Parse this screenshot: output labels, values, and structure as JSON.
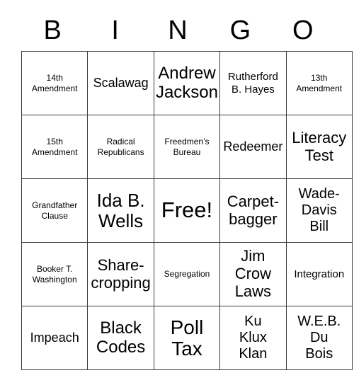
{
  "card": {
    "title": "BINGO",
    "headers": [
      "B",
      "I",
      "N",
      "G",
      "O"
    ],
    "free_space_label": "Free!",
    "rows": [
      [
        {
          "label": "14th\nAmendment",
          "size": "t-xs"
        },
        {
          "label": "Scalawag",
          "size": "t-md"
        },
        {
          "label": "Andrew\nJackson",
          "size": "t-2xl"
        },
        {
          "label": "Rutherford\nB. Hayes",
          "size": "t-sm"
        },
        {
          "label": "13th\nAmendment",
          "size": "t-xs"
        }
      ],
      [
        {
          "label": "15th\nAmendment",
          "size": "t-xs"
        },
        {
          "label": "Radical\nRepublicans",
          "size": "t-xs"
        },
        {
          "label": "Freedmen’s\nBureau",
          "size": "t-xs"
        },
        {
          "label": "Redeemer",
          "size": "t-md"
        },
        {
          "label": "Literacy\nTest",
          "size": "t-xl"
        }
      ],
      [
        {
          "label": "Grandfather\nClause",
          "size": "t-xs"
        },
        {
          "label": "Ida B.\nWells",
          "size": "t-3xl"
        },
        {
          "label": "Free!",
          "size": "t-5xl"
        },
        {
          "label": "Carpet-\nbagger",
          "size": "t-xl"
        },
        {
          "label": "Wade-\nDavis\nBill",
          "size": "t-lg"
        }
      ],
      [
        {
          "label": "Booker T.\nWashington",
          "size": "t-xs"
        },
        {
          "label": "Share-\ncropping",
          "size": "t-xl"
        },
        {
          "label": "Segregation",
          "size": "t-xs"
        },
        {
          "label": "Jim\nCrow\nLaws",
          "size": "t-xl"
        },
        {
          "label": "Integration",
          "size": "t-sm"
        }
      ],
      [
        {
          "label": "Impeach",
          "size": "t-md"
        },
        {
          "label": "Black\nCodes",
          "size": "t-2xl"
        },
        {
          "label": "Poll\nTax",
          "size": "t-4xl"
        },
        {
          "label": "Ku\nKlux\nKlan",
          "size": "t-lg"
        },
        {
          "label": "W.E.B.\nDu\nBois",
          "size": "t-lg"
        }
      ]
    ]
  },
  "colors": {
    "background": "#ffffff",
    "text": "#000000",
    "grid_line": "#3a3a3a"
  }
}
